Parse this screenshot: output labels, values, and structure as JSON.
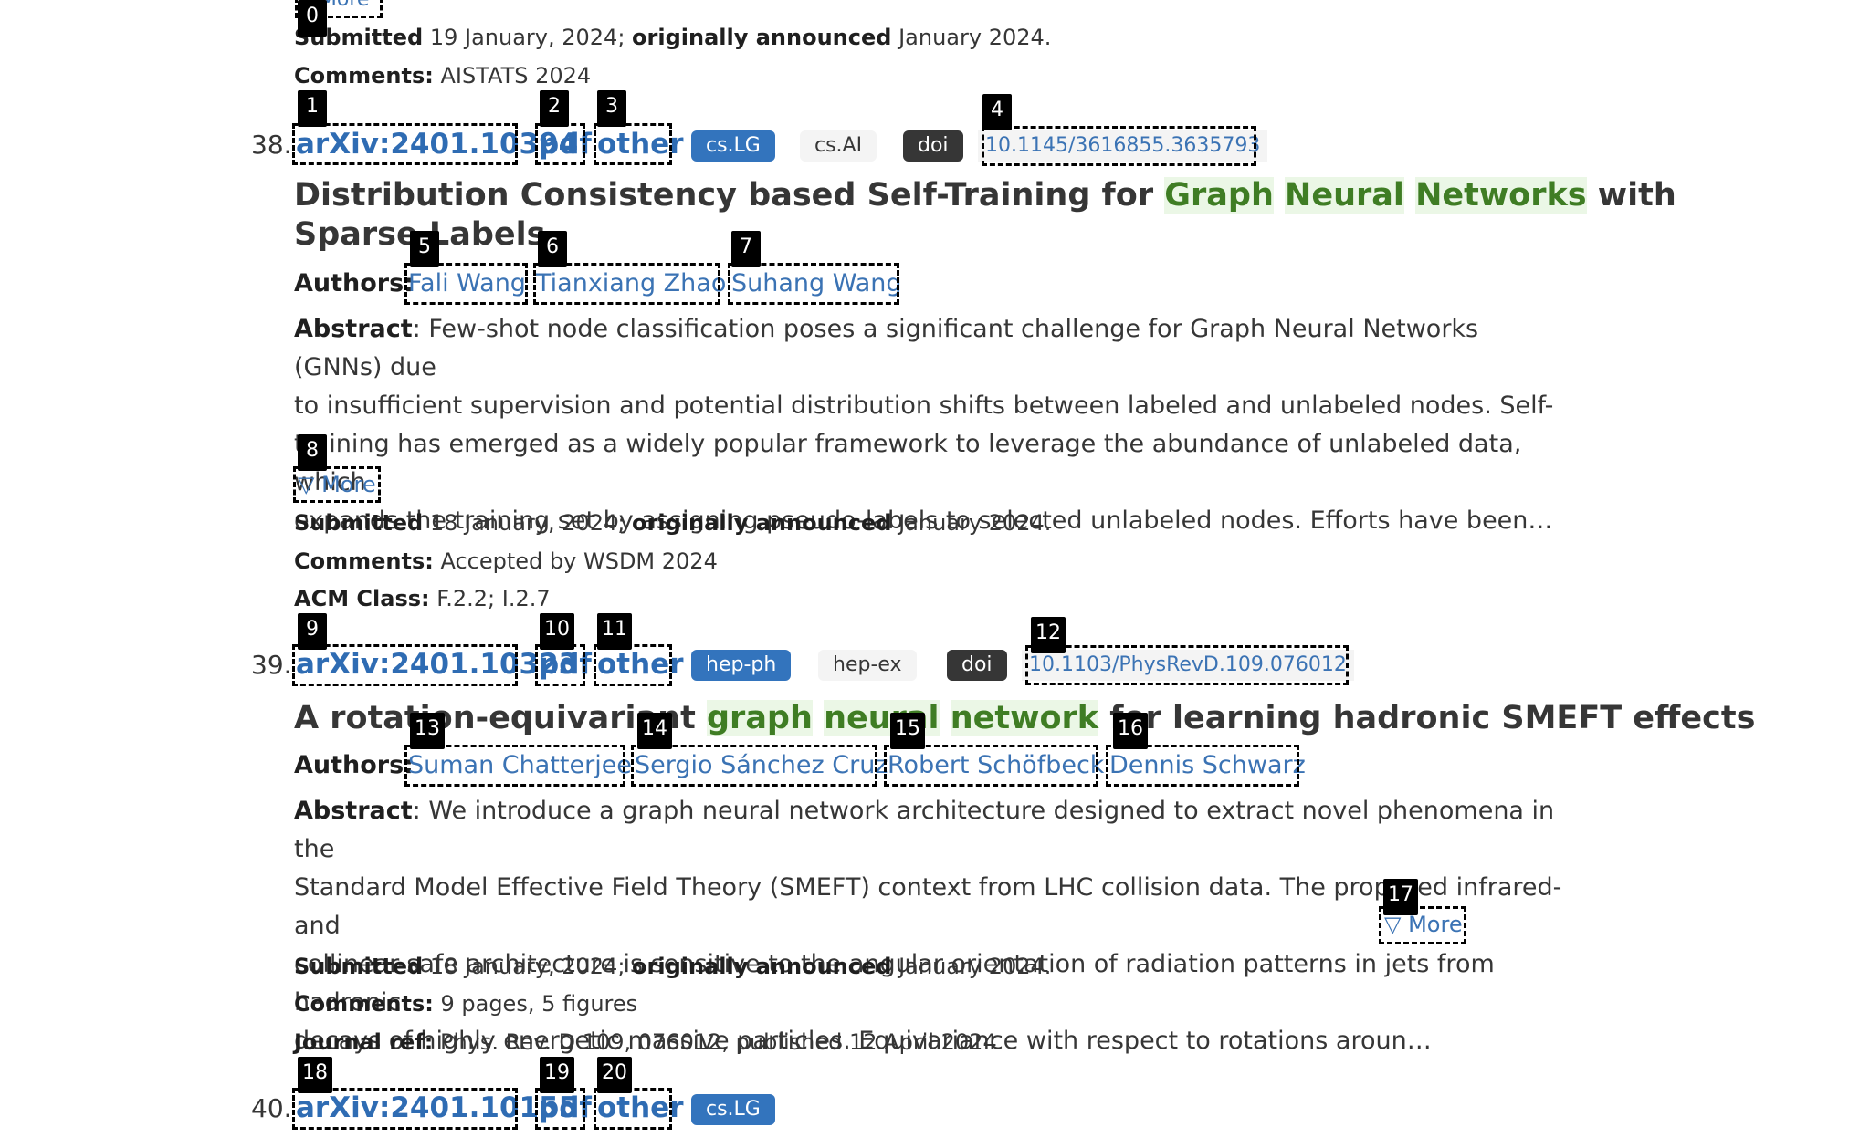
{
  "top_partial": {
    "more_label": "▽ More",
    "submitted_label": "Submitted",
    "submitted_value": "19 January, 2024;",
    "announced_label": "originally announced",
    "announced_value": "January 2024.",
    "comments_label": "Comments:",
    "comments_value": "AISTATS 2024"
  },
  "entries": [
    {
      "number": "38.",
      "id": "arXiv:2401.10394",
      "pdf": "pdf",
      "other": "other",
      "tags": [
        "cs.LG",
        "cs.AI"
      ],
      "doi_label": "doi",
      "doi_value": "10.1145/3616855.3635793",
      "title_pre": "Distribution Consistency based Self-Training for",
      "title_hl": [
        "Graph",
        "Neural",
        "Networks"
      ],
      "title_post": "with",
      "title_line2": "Sparse Labels",
      "authors_label": "Authors:",
      "authors": [
        "Fali Wang",
        "Tianxiang Zhao",
        "Suhang Wang"
      ],
      "abstract_label": "Abstract",
      "abstract_lines": [
        ": Few-shot node classification poses a significant challenge for Graph Neural Networks (GNNs) due",
        "to insufficient supervision and potential distribution shifts between labeled and unlabeled nodes. Self-",
        "training has emerged as a widely popular framework to leverage the abundance of unlabeled data, which",
        "expands the training set by assigning pseudo-labels to selected unlabeled nodes. Efforts have been…"
      ],
      "more_label": "▽ More",
      "submitted_label": "Submitted",
      "submitted_value": "18 January, 2024;",
      "announced_label": "originally announced",
      "announced_value": "January 2024.",
      "comments_label": "Comments:",
      "comments_value": "Accepted by WSDM 2024",
      "acm_label": "ACM Class:",
      "acm_value": "F.2.2; I.2.7"
    },
    {
      "number": "39.",
      "id": "arXiv:2401.10323",
      "pdf": "pdf",
      "other": "other",
      "tags": [
        "hep-ph",
        "hep-ex"
      ],
      "doi_label": "doi",
      "doi_value": "10.1103/PhysRevD.109.076012",
      "title_pre": "A rotation-equivariant",
      "title_hl": [
        "graph",
        "neural",
        "network"
      ],
      "title_post": "for learning hadronic SMEFT effects",
      "authors_label": "Authors:",
      "authors": [
        "Suman Chatterjee",
        "Sergio Sánchez Cruz",
        "Robert Schöfbeck",
        "Dennis Schwarz"
      ],
      "abstract_label": "Abstract",
      "abstract_lines": [
        ": We introduce a graph neural network architecture designed to extract novel phenomena in the",
        "Standard Model Effective Field Theory (SMEFT) context from LHC collision data. The proposed infrared- and",
        "collinear-safe architecture is sensitive to the angular orientation of radiation patterns in jets from hadronic",
        "decays of highly energetic massive particles. Equivariance with respect to rotations aroun…"
      ],
      "more_label": "▽ More",
      "submitted_label": "Submitted",
      "submitted_value": "18 January, 2024;",
      "announced_label": "originally announced",
      "announced_value": "January 2024.",
      "comments_label": "Comments:",
      "comments_value": "9 pages, 5 figures",
      "journal_label": "Journal ref:",
      "journal_value": "Phys. Rev. D 109, 076012, published 12 April 2024"
    },
    {
      "number": "40.",
      "id": "arXiv:2401.10155",
      "pdf": "pdf",
      "other": "other",
      "tags": [
        "cs.LG"
      ]
    }
  ],
  "badges": [
    "0",
    "1",
    "2",
    "3",
    "4",
    "5",
    "6",
    "7",
    "8",
    "9",
    "10",
    "11",
    "12",
    "13",
    "14",
    "15",
    "16",
    "17",
    "18",
    "19",
    "20"
  ]
}
